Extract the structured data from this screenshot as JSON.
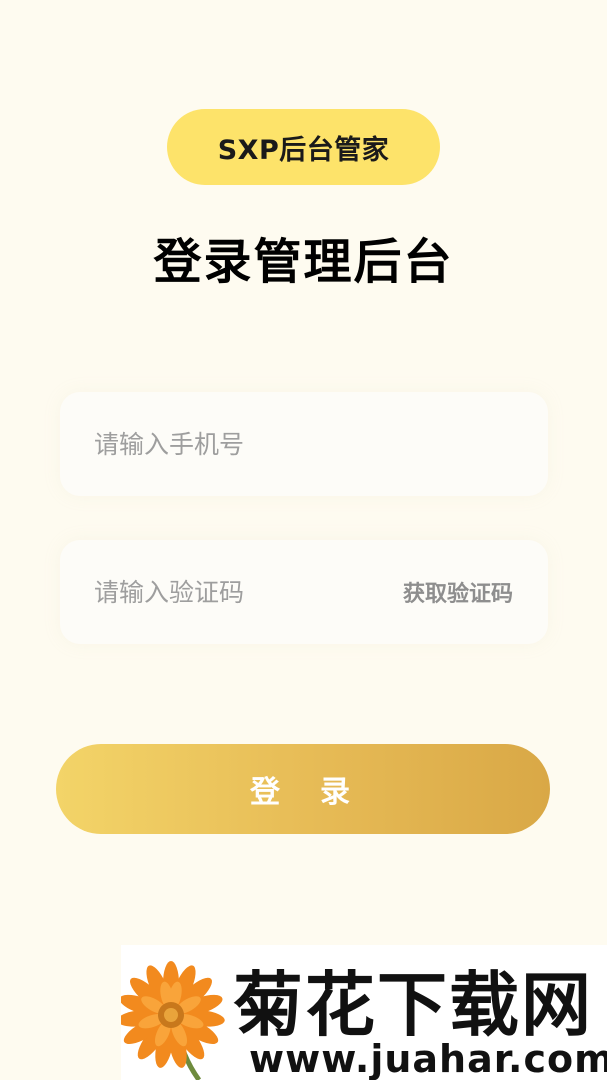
{
  "app": {
    "badge_label": "SXP后台管家"
  },
  "page": {
    "title": "登录管理后台"
  },
  "form": {
    "phone_placeholder": "请输入手机号",
    "phone_value": "",
    "code_placeholder": "请输入验证码",
    "code_value": "",
    "get_code_label": "获取验证码",
    "login_label": "登录"
  },
  "watermark": {
    "title": "菊花下载网",
    "url": "www.juahar.com"
  },
  "colors": {
    "background": "#FEFBF0",
    "badge": "#FDE36A",
    "button_start": "#F3D468",
    "button_end": "#D9A846"
  }
}
